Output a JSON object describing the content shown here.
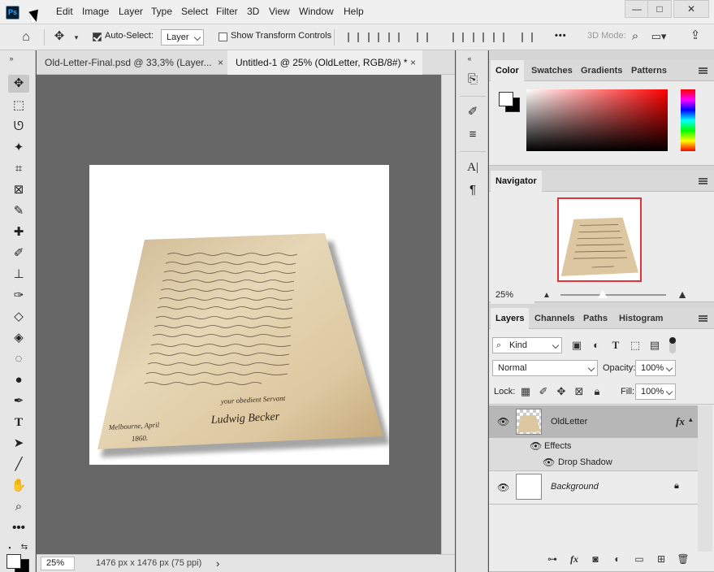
{
  "app": {
    "logo": "Ps",
    "menu": [
      "Edit",
      "Image",
      "Layer",
      "Type",
      "Select",
      "Filter",
      "3D",
      "View",
      "Window",
      "Help"
    ],
    "window_controls": [
      "minimize-icon",
      "maximize-icon",
      "close-icon"
    ]
  },
  "options_bar": {
    "auto_select_label": "Auto-Select:",
    "auto_select_checked": true,
    "auto_select_target": "Layer",
    "show_transform_label": "Show Transform Controls",
    "show_transform_checked": false,
    "more": "•••",
    "mode_3d_label": "3D Mode:"
  },
  "tabs": [
    {
      "label": "Old-Letter-Final.psd @ 33,3% (Layer...",
      "close": "×",
      "active": false
    },
    {
      "label": "Untitled-1 @ 25% (OldLetter, RGB/8#) *",
      "close": "×",
      "active": true
    }
  ],
  "status": {
    "zoom": "25%",
    "doc_info": "1476 px x 1476 px (75 ppi)",
    "arrow": "›"
  },
  "colors": {
    "foreground": "#ffffff",
    "background": "#000000",
    "letter_paper": "#dcc7a0",
    "navigator_frame": "#e0343a"
  },
  "color_panel": {
    "tabs": [
      "Color",
      "Swatches",
      "Gradients",
      "Patterns"
    ],
    "active_tab": "Color"
  },
  "navigator_panel": {
    "title": "Navigator",
    "zoom": "25%"
  },
  "layers_panel": {
    "tabs": [
      "Layers",
      "Channels",
      "Paths",
      "Histogram"
    ],
    "active_tab": "Layers",
    "filter_kind": "Kind",
    "blend_mode": "Normal",
    "opacity_label": "Opacity:",
    "opacity": "100%",
    "lock_label": "Lock:",
    "fill_label": "Fill:",
    "fill": "100%",
    "layers": [
      {
        "name": "OldLetter",
        "fx": "fx",
        "effects_label": "Effects",
        "effects": [
          "Drop Shadow"
        ],
        "selected": true
      },
      {
        "name": "Background",
        "locked": true,
        "selected": false
      }
    ]
  },
  "letter_text": {
    "signoff": "your obedient Servant",
    "signature": "Ludwig Becker",
    "place_date_1": "Melbourne, April",
    "place_date_2": "1860."
  }
}
